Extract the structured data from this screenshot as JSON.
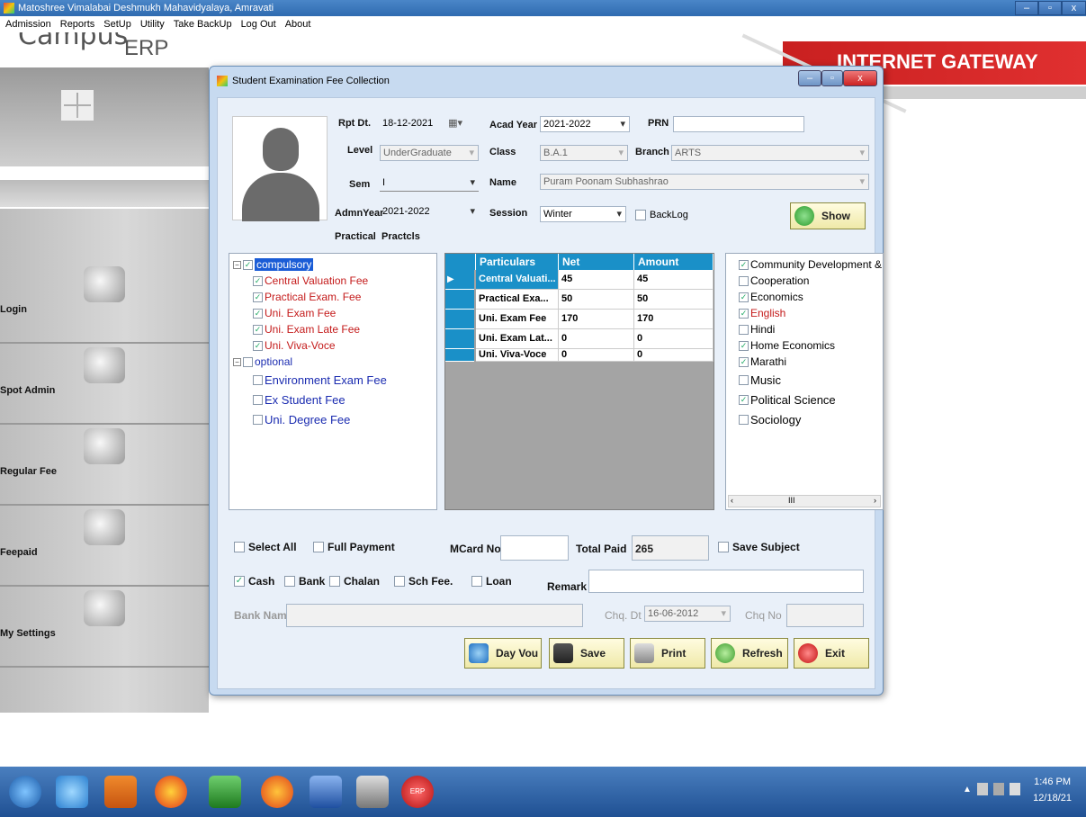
{
  "app": {
    "title": "Matoshree Vimalabai Deshmukh Mahavidyalaya, Amravati",
    "menu": [
      "Admission",
      "Reports",
      "SetUp",
      "Utility",
      "Take BackUp",
      "Log Out",
      "About"
    ]
  },
  "background": {
    "logo_top": "Campus",
    "logo_bottom": "ERP",
    "banner": "INTERNET GATEWAY",
    "side_menu": [
      "Login",
      "Spot Admin",
      "Regular Fee",
      "Feepaid",
      "My Settings"
    ]
  },
  "dialog": {
    "title": "Student Examination Fee Collection",
    "labels": {
      "rpt_dt": "Rpt Dt.",
      "acad_year": "Acad Year",
      "prn": "PRN",
      "level": "Level",
      "class": "Class",
      "branch": "Branch",
      "sem": "Sem",
      "name": "Name",
      "admn_year": "AdmnYear",
      "session": "Session",
      "backlog": "BackLog",
      "practical": "Practical",
      "practical_value": "Practcls"
    },
    "values": {
      "rpt_dt": "18-12-2021",
      "acad_year": "2021-2022",
      "prn": "",
      "level": "UnderGraduate",
      "class": "B.A.1",
      "branch": "ARTS",
      "sem": "I",
      "name": "Puram Poonam Subhashrao",
      "admn_year": "2021-2022",
      "session": "Winter"
    },
    "show_button": "Show",
    "tree": {
      "compulsory": "compulsory",
      "compulsory_items": [
        "Central Valuation Fee",
        "Practical Exam. Fee",
        "Uni. Exam Fee",
        "Uni. Exam Late Fee",
        "Uni. Viva-Voce"
      ],
      "optional": "optional",
      "optional_items": [
        "Environment Exam Fee",
        "Ex Student Fee",
        "Uni. Degree Fee"
      ]
    },
    "grid": {
      "headers": [
        "Particulars",
        "Net",
        "Amount"
      ],
      "rows": [
        [
          "Central Valuati...",
          "45",
          "45"
        ],
        [
          "Practical Exa...",
          "50",
          "50"
        ],
        [
          "Uni. Exam Fee",
          "170",
          "170"
        ],
        [
          "Uni. Exam Lat...",
          "0",
          "0"
        ],
        [
          "Uni. Viva-Voce",
          "0",
          "0"
        ]
      ]
    },
    "subjects": [
      {
        "name": "Community Development &",
        "checked": true,
        "color": "#000000"
      },
      {
        "name": "Cooperation",
        "checked": false,
        "color": "#000000"
      },
      {
        "name": "Economics",
        "checked": true,
        "color": "#000000"
      },
      {
        "name": "English",
        "checked": true,
        "color": "#c41a1a"
      },
      {
        "name": "Hindi",
        "checked": false,
        "color": "#000000"
      },
      {
        "name": "Home Economics",
        "checked": true,
        "color": "#000000"
      },
      {
        "name": "Marathi",
        "checked": true,
        "color": "#000000"
      },
      {
        "name": "Music",
        "checked": false,
        "color": "#000000"
      },
      {
        "name": "Political Science",
        "checked": true,
        "color": "#000000"
      },
      {
        "name": "Sociology",
        "checked": false,
        "color": "#000000"
      }
    ],
    "scroll_marker": "III",
    "footer": {
      "select_all": "Select All",
      "full_payment": "Full Payment",
      "mcard_no": "MCard No",
      "mcard_value": "",
      "total_paid": "Total Paid",
      "total_paid_value": "265",
      "save_subject": "Save Subject",
      "cash": "Cash",
      "bank": "Bank",
      "chalan": "Chalan",
      "sch_fee": "Sch Fee.",
      "loan": "Loan",
      "remark": "Remark",
      "bank_name": "Bank Name",
      "chq_dt": "Chq. Dt",
      "chq_dt_value": "16-06-2012",
      "chq_no": "Chq No"
    },
    "buttons": [
      "Day Vou",
      "Save",
      "Print",
      "Refresh",
      "Exit"
    ]
  },
  "taskbar": {
    "time": "1:46 PM",
    "date": "12/18/21",
    "erp_label": "ERP"
  }
}
